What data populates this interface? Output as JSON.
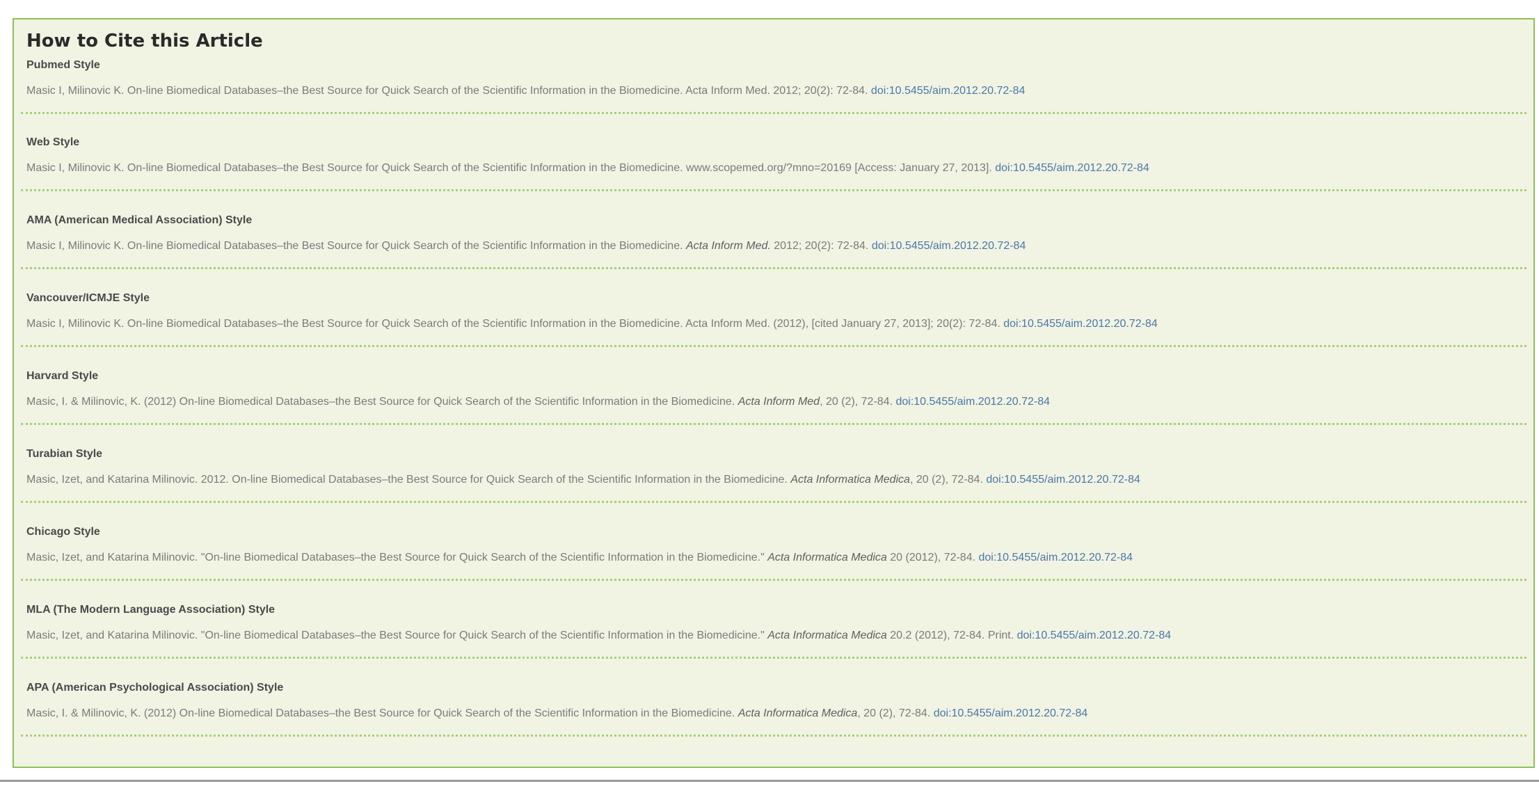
{
  "box": {
    "title": "How to Cite this Article"
  },
  "citations": [
    {
      "style": "Pubmed Style",
      "text": "Masic I, Milinovic K. On-line Biomedical Databases–the Best Source for Quick Search of the Scientific Information in the Biomedicine. Acta Inform Med. 2012; 20(2): 72-84.",
      "italic": "",
      "after": "",
      "doi": "doi:10.5455/aim.2012.20.72-84"
    },
    {
      "style": "Web Style",
      "text": "Masic I, Milinovic K. On-line Biomedical Databases–the Best Source for Quick Search of the Scientific Information in the Biomedicine. www.scopemed.org/?mno=20169 [Access: January 27, 2013].",
      "italic": "",
      "after": "",
      "doi": "doi:10.5455/aim.2012.20.72-84"
    },
    {
      "style": "AMA (American Medical Association) Style",
      "text": "Masic I, Milinovic K. On-line Biomedical Databases–the Best Source for Quick Search of the Scientific Information in the Biomedicine.",
      "italic": "Acta Inform Med.",
      "after": "2012; 20(2): 72-84.",
      "doi": "doi:10.5455/aim.2012.20.72-84"
    },
    {
      "style": "Vancouver/ICMJE Style",
      "text": "Masic I, Milinovic K. On-line Biomedical Databases–the Best Source for Quick Search of the Scientific Information in the Biomedicine. Acta Inform Med. (2012), [cited January 27, 2013]; 20(2): 72-84.",
      "italic": "",
      "after": "",
      "doi": "doi:10.5455/aim.2012.20.72-84"
    },
    {
      "style": "Harvard Style",
      "text": "Masic, I. & Milinovic, K. (2012) On-line Biomedical Databases–the Best Source for Quick Search of the Scientific Information in the Biomedicine.",
      "italic": "Acta Inform Med",
      "after": ", 20 (2), 72-84.",
      "doi": "doi:10.5455/aim.2012.20.72-84"
    },
    {
      "style": "Turabian Style",
      "text": "Masic, Izet, and Katarina Milinovic. 2012. On-line Biomedical Databases–the Best Source for Quick Search of the Scientific Information in the Biomedicine.",
      "italic": "Acta Informatica Medica",
      "after": ", 20 (2), 72-84.",
      "doi": "doi:10.5455/aim.2012.20.72-84"
    },
    {
      "style": "Chicago Style",
      "text": "Masic, Izet, and Katarina Milinovic. \"On-line Biomedical Databases–the Best Source for Quick Search of the Scientific Information in the Biomedicine.\"",
      "italic": "Acta Informatica Medica",
      "after": "20 (2012), 72-84.",
      "doi": "doi:10.5455/aim.2012.20.72-84"
    },
    {
      "style": "MLA (The Modern Language Association) Style",
      "text": "Masic, Izet, and Katarina Milinovic. \"On-line Biomedical Databases–the Best Source for Quick Search of the Scientific Information in the Biomedicine.\"",
      "italic": "Acta Informatica Medica",
      "after": "20.2 (2012), 72-84. Print.",
      "doi": "doi:10.5455/aim.2012.20.72-84"
    },
    {
      "style": "APA (American Psychological Association) Style",
      "text": "Masic, I. & Milinovic, K. (2012) On-line Biomedical Databases–the Best Source for Quick Search of the Scientific Information in the Biomedicine.",
      "italic": "Acta Informatica Medica",
      "after": ", 20 (2), 72-84.",
      "doi": "doi:10.5455/aim.2012.20.72-84"
    }
  ],
  "colors": {
    "box_background": "#f1f3e3",
    "box_border": "#8cc156",
    "divider": "#a8d07a",
    "link": "#4a78a8",
    "body_text": "#7b7b7b",
    "heading_text": "#4a4a4a"
  }
}
